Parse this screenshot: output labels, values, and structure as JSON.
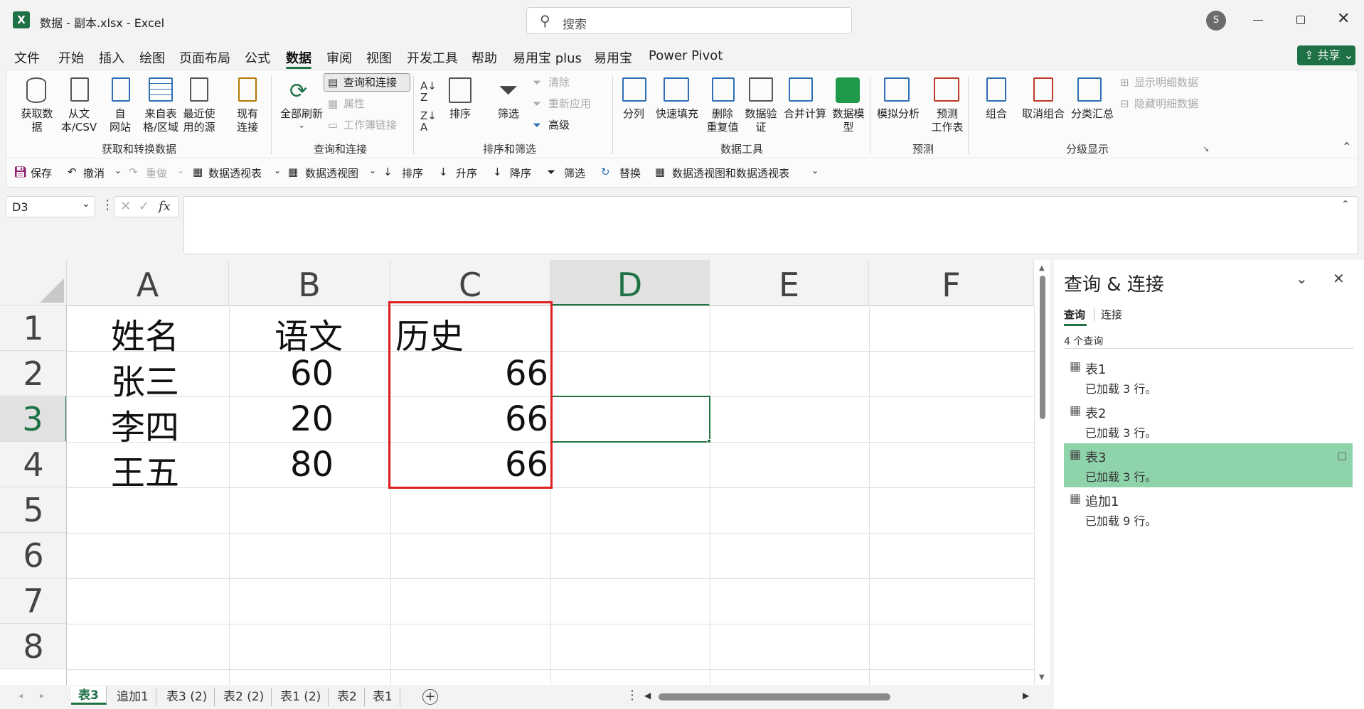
{
  "window": {
    "title": "数据 - 副本.xlsx  -  Excel",
    "search_placeholder": "搜索",
    "avatar_initial": "S"
  },
  "menu": {
    "items": [
      "文件",
      "开始",
      "插入",
      "绘图",
      "页面布局",
      "公式",
      "数据",
      "审阅",
      "视图",
      "开发工具",
      "帮助",
      "易用宝 plus",
      "易用宝",
      "Power Pivot"
    ],
    "active": "数据",
    "share_label": "共享"
  },
  "ribbon": {
    "get": {
      "btn1": "获取数\n据",
      "btn2": "从文\n本/CSV",
      "btn3": "自\n网站",
      "btn4": "来自表\n格/区域",
      "btn5": "最近使\n用的源",
      "btn6": "现有\n连接",
      "label": "获取和转换数据"
    },
    "query": {
      "refresh": "全部刷新",
      "queries": "查询和连接",
      "props": "属性",
      "links": "工作簿链接",
      "label": "查询和连接"
    },
    "sort": {
      "sort": "排序",
      "filter": "筛选",
      "clear": "清除",
      "reapply": "重新应用",
      "advanced": "高级",
      "label": "排序和筛选"
    },
    "tools": {
      "split": "分列",
      "flash": "快速填充",
      "dedupe": "删除\n重复值",
      "validate": "数据验\n证",
      "consolidate": "合并计算",
      "model": "数据模\n型",
      "label": "数据工具"
    },
    "forecast": {
      "whatif": "模拟分析",
      "sheet": "预测\n工作表",
      "label": "预测"
    },
    "outline": {
      "group": "组合",
      "ungroup": "取消组合",
      "subtotal": "分类汇总",
      "show": "显示明细数据",
      "hide": "隐藏明细数据",
      "label": "分级显示"
    }
  },
  "qat": {
    "save": "保存",
    "undo": "撤消",
    "redo": "重做",
    "pivot_table": "数据透视表",
    "pivot_chart": "数据透视图",
    "sort": "排序",
    "asc": "升序",
    "desc": "降序",
    "filter": "筛选",
    "replace": "替换",
    "pivot_both": "数据透视图和数据透视表"
  },
  "formula": {
    "name_box": "D3",
    "fx": "fx",
    "content": ""
  },
  "sheet": {
    "columns": [
      "A",
      "B",
      "C",
      "D",
      "E",
      "F"
    ],
    "rows": [
      "1",
      "2",
      "3",
      "4",
      "5",
      "6",
      "7",
      "8"
    ],
    "cells": {
      "A1": "姓名",
      "B1": "语文",
      "C1": "历史",
      "A2": "张三",
      "B2": "60",
      "C2": "66",
      "A3": "李四",
      "B3": "20",
      "C3": "66",
      "A4": "王五",
      "B4": "80",
      "C4": "66"
    },
    "selected": "D3"
  },
  "panel": {
    "title": "查询 & 连接",
    "tabs": [
      "查询",
      "连接"
    ],
    "count": "4 个查询",
    "queries": [
      {
        "name": "表1",
        "status": "已加载 3 行。"
      },
      {
        "name": "表2",
        "status": "已加载 3 行。"
      },
      {
        "name": "表3",
        "status": "已加载 3 行。"
      },
      {
        "name": "追加1",
        "status": "已加载 9 行。"
      }
    ],
    "highlight_color": "#8fd3ab"
  },
  "sheet_tabs": [
    "表3",
    "追加1",
    "表3 (2)",
    "表2 (2)",
    "表1 (2)",
    "表2",
    "表1"
  ],
  "colors": {
    "accent": "#217346",
    "highlight_box": "#e02020"
  }
}
